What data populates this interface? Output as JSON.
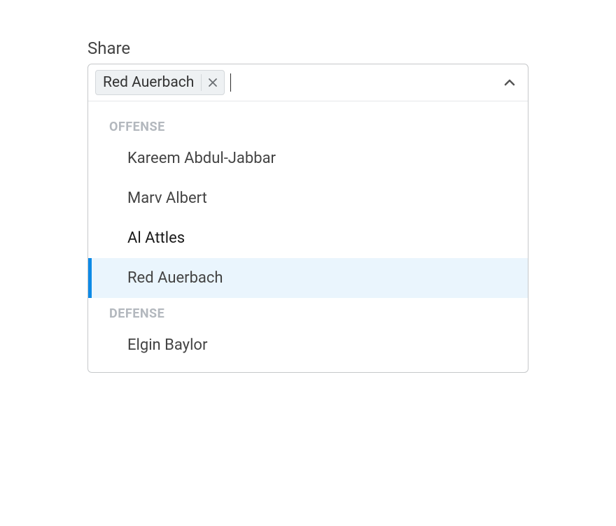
{
  "label": "Share",
  "selectedChip": "Red Auerbach",
  "groups": [
    {
      "name": "OFFENSE",
      "options": [
        {
          "label": "Kareem Abdul-Jabbar",
          "highlighted": false,
          "dark": false
        },
        {
          "label": "Marv Albert",
          "highlighted": false,
          "dark": false
        },
        {
          "label": "Al Attles",
          "highlighted": false,
          "dark": true
        },
        {
          "label": "Red Auerbach",
          "highlighted": true,
          "dark": false
        }
      ]
    },
    {
      "name": "DEFENSE",
      "options": [
        {
          "label": "Elgin Baylor",
          "highlighted": false,
          "dark": false
        }
      ]
    }
  ]
}
